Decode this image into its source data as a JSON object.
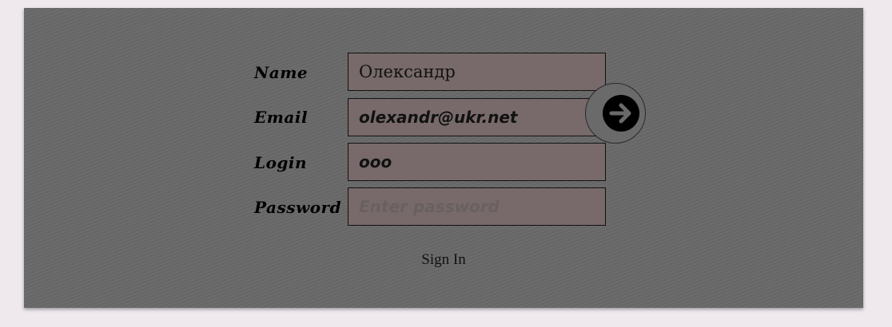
{
  "form": {
    "fields": [
      {
        "label": "Name",
        "value": "Олександр",
        "placeholder": ""
      },
      {
        "label": "Email",
        "value": "olexandr@ukr.net",
        "placeholder": ""
      },
      {
        "label": "Login",
        "value": "ooo",
        "placeholder": ""
      },
      {
        "label": "Password",
        "value": "",
        "placeholder": "Enter password"
      }
    ],
    "submit_icon": "arrow-right-circle-icon",
    "signin_label": "Sign In"
  },
  "colors": {
    "page_bg": "#efe9ee",
    "panel_bg": "#6a6a6a",
    "field_bg": "#786a6a",
    "text": "#000000"
  }
}
